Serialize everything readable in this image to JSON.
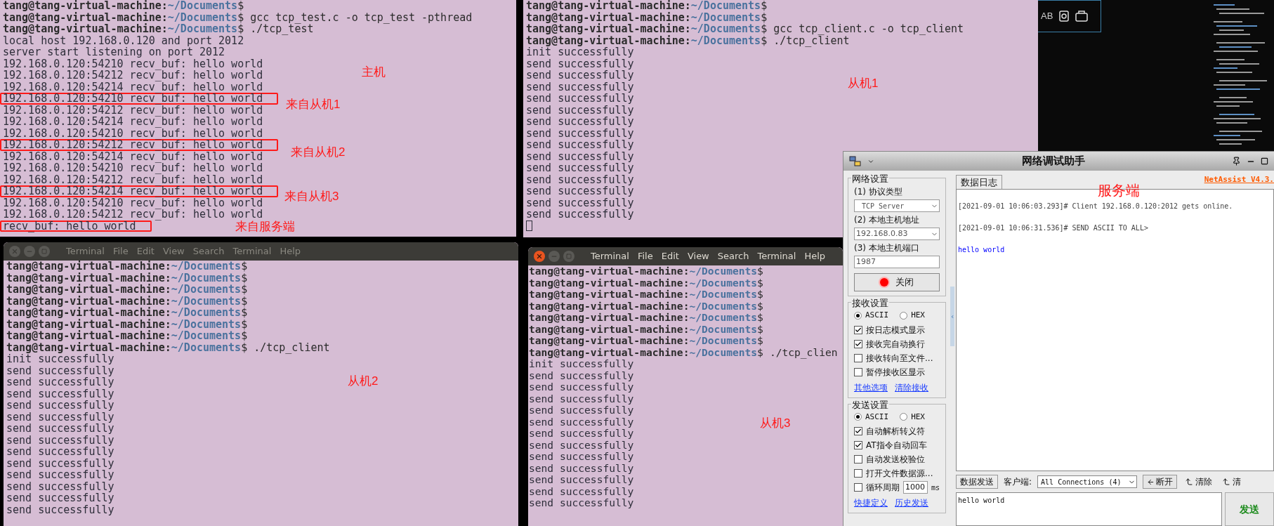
{
  "terminals": [
    {
      "lines": [
        {
          "kind": "prompt",
          "user": "tang@tang-virtual-machine:",
          "path": "~/Documents",
          "sign": "$"
        },
        {
          "kind": "prompt",
          "user": "tang@tang-virtual-machine:",
          "path": "~/Documents",
          "sign": "$",
          "command": "gcc tcp_test.c -o tcp_test -pthread"
        },
        {
          "kind": "prompt",
          "user": "tang@tang-virtual-machine:",
          "path": "~/Documents",
          "sign": "$",
          "command": "./tcp_test"
        },
        {
          "kind": "output",
          "text": "local host 192.168.0.120 and port 2012",
          "highlighted": false
        },
        {
          "kind": "output",
          "text": "server start listening on port 2012",
          "highlighted": false
        },
        {
          "kind": "output",
          "text": "192.168.0.120:54210 recv_buf: hello world",
          "highlighted": false
        },
        {
          "kind": "output",
          "text": "192.168.0.120:54212 recv_buf: hello world",
          "highlighted": false
        },
        {
          "kind": "output",
          "text": "192.168.0.120:54214 recv_buf: hello world",
          "highlighted": false
        },
        {
          "kind": "output",
          "text": "192.168.0.120:54210 recv_buf: hello world",
          "highlighted": true
        },
        {
          "kind": "output",
          "text": "192.168.0.120:54212 recv_buf: hello world",
          "highlighted": false
        },
        {
          "kind": "output",
          "text": "192.168.0.120:54214 recv_buf: hello world",
          "highlighted": false
        },
        {
          "kind": "output",
          "text": "192.168.0.120:54210 recv_buf: hello world",
          "highlighted": false
        },
        {
          "kind": "output",
          "text": "192.168.0.120:54212 recv_buf: hello world",
          "highlighted": true
        },
        {
          "kind": "output",
          "text": "192.168.0.120:54214 recv_buf: hello world",
          "highlighted": false
        },
        {
          "kind": "output",
          "text": "192.168.0.120:54210 recv_buf: hello world",
          "highlighted": false
        },
        {
          "kind": "output",
          "text": "192.168.0.120:54212 recv_buf: hello world",
          "highlighted": false
        },
        {
          "kind": "output",
          "text": "192.168.0.120:54214 recv_buf: hello world",
          "highlighted": true
        },
        {
          "kind": "output",
          "text": "192.168.0.120:54210 recv_buf: hello world",
          "highlighted": false
        },
        {
          "kind": "output",
          "text": "192.168.0.120:54212 recv_buf: hello world",
          "highlighted": false
        },
        {
          "kind": "output",
          "text": "recv_buf: hello world",
          "highlighted": true
        }
      ]
    },
    {
      "cursor": true,
      "lines": [
        {
          "kind": "prompt",
          "user": "tang@tang-virtual-machine:",
          "path": "~/Documents",
          "sign": "$"
        },
        {
          "kind": "prompt",
          "user": "tang@tang-virtual-machine:",
          "path": "~/Documents",
          "sign": "$"
        },
        {
          "kind": "prompt",
          "user": "tang@tang-virtual-machine:",
          "path": "~/Documents",
          "sign": "$",
          "command": "gcc tcp_client.c -o tcp_client"
        },
        {
          "kind": "prompt",
          "user": "tang@tang-virtual-machine:",
          "path": "~/Documents",
          "sign": "$",
          "command": "./tcp_client"
        },
        {
          "kind": "output",
          "text": "init successfully",
          "highlighted": false
        },
        {
          "kind": "output",
          "text": "send successfully",
          "highlighted": false
        },
        {
          "kind": "output",
          "text": "send successfully",
          "highlighted": false
        },
        {
          "kind": "output",
          "text": "send successfully",
          "highlighted": false
        },
        {
          "kind": "output",
          "text": "send successfully",
          "highlighted": false
        },
        {
          "kind": "output",
          "text": "send successfully",
          "highlighted": false
        },
        {
          "kind": "output",
          "text": "send successfully",
          "highlighted": false
        },
        {
          "kind": "output",
          "text": "send successfully",
          "highlighted": false
        },
        {
          "kind": "output",
          "text": "send successfully",
          "highlighted": false
        },
        {
          "kind": "output",
          "text": "send successfully",
          "highlighted": false
        },
        {
          "kind": "output",
          "text": "send successfully",
          "highlighted": false
        },
        {
          "kind": "output",
          "text": "send successfully",
          "highlighted": false
        },
        {
          "kind": "output",
          "text": "send successfully",
          "highlighted": false
        },
        {
          "kind": "output",
          "text": "send successfully",
          "highlighted": false
        },
        {
          "kind": "output",
          "text": "send successfully",
          "highlighted": false
        }
      ]
    },
    {
      "active": false,
      "menu": [
        "Terminal",
        "File",
        "Edit",
        "View",
        "Search",
        "Terminal",
        "Help"
      ],
      "lines": [
        {
          "kind": "prompt",
          "user": "tang@tang-virtual-machine:",
          "path": "~/Documents",
          "sign": "$"
        },
        {
          "kind": "prompt",
          "user": "tang@tang-virtual-machine:",
          "path": "~/Documents",
          "sign": "$"
        },
        {
          "kind": "prompt",
          "user": "tang@tang-virtual-machine:",
          "path": "~/Documents",
          "sign": "$"
        },
        {
          "kind": "prompt",
          "user": "tang@tang-virtual-machine:",
          "path": "~/Documents",
          "sign": "$"
        },
        {
          "kind": "prompt",
          "user": "tang@tang-virtual-machine:",
          "path": "~/Documents",
          "sign": "$"
        },
        {
          "kind": "prompt",
          "user": "tang@tang-virtual-machine:",
          "path": "~/Documents",
          "sign": "$"
        },
        {
          "kind": "prompt",
          "user": "tang@tang-virtual-machine:",
          "path": "~/Documents",
          "sign": "$"
        },
        {
          "kind": "prompt",
          "user": "tang@tang-virtual-machine:",
          "path": "~/Documents",
          "sign": "$",
          "command": "./tcp_client"
        },
        {
          "kind": "output",
          "text": "init successfully",
          "highlighted": false
        },
        {
          "kind": "output",
          "text": "send successfully",
          "highlighted": false
        },
        {
          "kind": "output",
          "text": "send successfully",
          "highlighted": false
        },
        {
          "kind": "output",
          "text": "send successfully",
          "highlighted": false
        },
        {
          "kind": "output",
          "text": "send successfully",
          "highlighted": false
        },
        {
          "kind": "output",
          "text": "send successfully",
          "highlighted": false
        },
        {
          "kind": "output",
          "text": "send successfully",
          "highlighted": false
        },
        {
          "kind": "output",
          "text": "send successfully",
          "highlighted": false
        },
        {
          "kind": "output",
          "text": "send successfully",
          "highlighted": false
        },
        {
          "kind": "output",
          "text": "send successfully",
          "highlighted": false
        },
        {
          "kind": "output",
          "text": "send successfully",
          "highlighted": false
        },
        {
          "kind": "output",
          "text": "send successfully",
          "highlighted": false
        },
        {
          "kind": "output",
          "text": "send successfully",
          "highlighted": false
        },
        {
          "kind": "output",
          "text": "send successfully",
          "highlighted": false
        }
      ]
    },
    {
      "active": true,
      "menu": [
        "Terminal",
        "File",
        "Edit",
        "View",
        "Search",
        "Terminal",
        "Help"
      ],
      "lines": [
        {
          "kind": "prompt",
          "user": "tang@tang-virtual-machine:",
          "path": "~/Documents",
          "sign": "$"
        },
        {
          "kind": "prompt",
          "user": "tang@tang-virtual-machine:",
          "path": "~/Documents",
          "sign": "$"
        },
        {
          "kind": "prompt",
          "user": "tang@tang-virtual-machine:",
          "path": "~/Documents",
          "sign": "$"
        },
        {
          "kind": "prompt",
          "user": "tang@tang-virtual-machine:",
          "path": "~/Documents",
          "sign": "$"
        },
        {
          "kind": "prompt",
          "user": "tang@tang-virtual-machine:",
          "path": "~/Documents",
          "sign": "$"
        },
        {
          "kind": "prompt",
          "user": "tang@tang-virtual-machine:",
          "path": "~/Documents",
          "sign": "$"
        },
        {
          "kind": "prompt",
          "user": "tang@tang-virtual-machine:",
          "path": "~/Documents",
          "sign": "$"
        },
        {
          "kind": "prompt",
          "user": "tang@tang-virtual-machine:",
          "path": "~/Documents",
          "sign": "$",
          "command": "./tcp_clien"
        },
        {
          "kind": "output",
          "text": "init successfully",
          "highlighted": false
        },
        {
          "kind": "output",
          "text": "send successfully",
          "highlighted": false
        },
        {
          "kind": "output",
          "text": "send successfully",
          "highlighted": false
        },
        {
          "kind": "output",
          "text": "send successfully",
          "highlighted": false
        },
        {
          "kind": "output",
          "text": "send successfully",
          "highlighted": false
        },
        {
          "kind": "output",
          "text": "send successfully",
          "highlighted": false
        },
        {
          "kind": "output",
          "text": "send successfully",
          "highlighted": false
        },
        {
          "kind": "output",
          "text": "send successfully",
          "highlighted": false
        },
        {
          "kind": "output",
          "text": "send successfully",
          "highlighted": false
        },
        {
          "kind": "output",
          "text": "send successfully",
          "highlighted": false
        },
        {
          "kind": "output",
          "text": "send successfully",
          "highlighted": false
        },
        {
          "kind": "output",
          "text": "send successfully",
          "highlighted": false
        },
        {
          "kind": "output",
          "text": "send successfully",
          "highlighted": false
        }
      ]
    }
  ],
  "code_panel": {
    "toggle": "AB"
  },
  "net_assist": {
    "title": "网络调试助手",
    "network_settings": {
      "legend": "网络设置",
      "protocol_label": "(1) 协议类型",
      "protocol": "TCP Server",
      "address_label": "(2) 本地主机地址",
      "address": "192.168.0.83",
      "port_label": "(3) 本地主机端口",
      "port": "1987",
      "open_button": "关闭",
      "connected": true
    },
    "receive_settings": {
      "legend": "接收设置",
      "modes": [
        {
          "label": "ASCII",
          "selected": true
        },
        {
          "label": "HEX",
          "selected": false
        }
      ],
      "options": [
        {
          "label": "按日志模式显示",
          "checked": true
        },
        {
          "label": "接收完自动换行",
          "checked": true
        },
        {
          "label": "接收转向至文件...",
          "checked": false
        },
        {
          "label": "暂停接收区显示",
          "checked": false
        }
      ],
      "links": [
        "其他选项",
        "清除接收"
      ]
    },
    "send_settings": {
      "legend": "发送设置",
      "modes": [
        {
          "label": "ASCII",
          "selected": true
        },
        {
          "label": "HEX",
          "selected": false
        }
      ],
      "options": [
        {
          "label": "自动解析转义符",
          "checked": true
        },
        {
          "label": "AT指令自动回车",
          "checked": true
        },
        {
          "label": "自动发送校验位",
          "checked": false
        },
        {
          "label": "打开文件数据源...",
          "checked": false
        },
        {
          "label": "循环周期",
          "checked": false,
          "value": "1000",
          "unit": "ms"
        }
      ],
      "links": [
        "快捷定义",
        "历史发送"
      ]
    },
    "log_tab": "数据日志",
    "version": "NetAssist V4.3.",
    "log": [
      {
        "kind": "status",
        "text": "[2021-09-01 10:06:03.293]# Client 192.168.0.120:2012 gets online."
      },
      {
        "kind": "status",
        "text": "[2021-09-01 10:06:31.536]# SEND ASCII TO ALL>"
      },
      {
        "kind": "data",
        "text": "hello world"
      }
    ],
    "send_tab": "数据发送",
    "client_label": "客户端:",
    "client_select": "All Connections (4)",
    "disconnect_button": "断开",
    "clear_buttons": [
      "清除",
      "清"
    ],
    "send_text": "hello world",
    "send_button": "发送"
  },
  "annotations": [
    "主机",
    "来自从机1",
    "来自从机2",
    "来自从机3",
    "来自服务端",
    "从机1",
    "从机2",
    "从机3",
    "服务端"
  ]
}
